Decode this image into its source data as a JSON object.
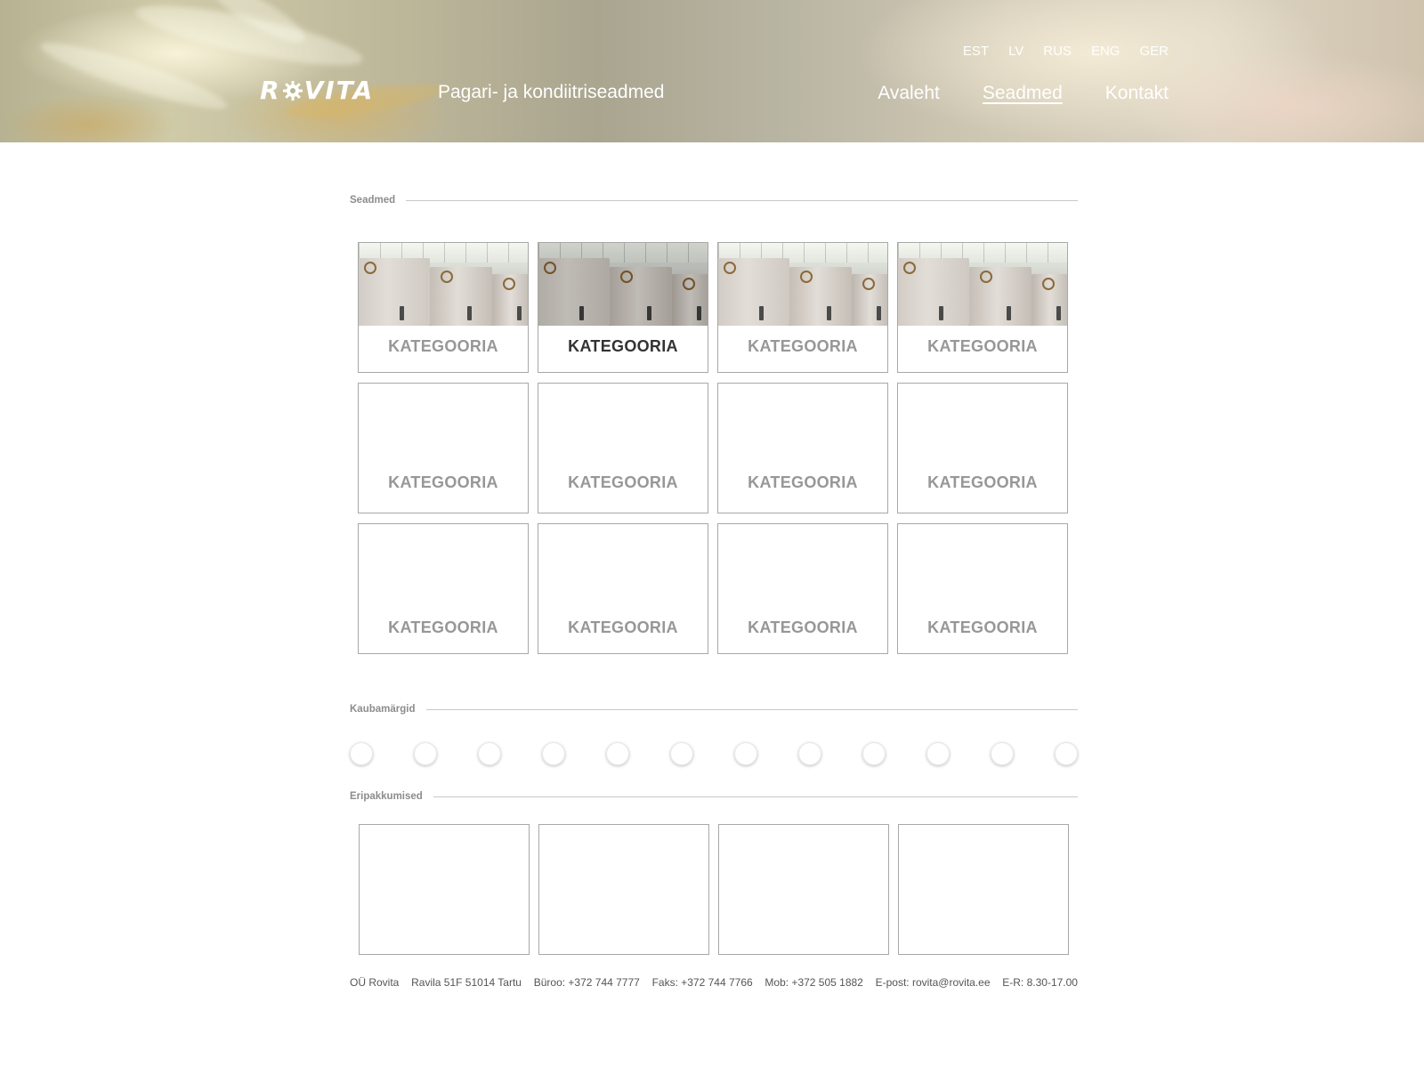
{
  "header": {
    "logo_text": "ROVITA",
    "tagline": "Pagari- ja kondiitriseadmed",
    "languages": [
      "EST",
      "LV",
      "RUS",
      "ENG",
      "GER"
    ],
    "nav": [
      {
        "label": "Avaleht",
        "active": false
      },
      {
        "label": "Seadmed",
        "active": true
      },
      {
        "label": "Kontakt",
        "active": false
      }
    ]
  },
  "sections": {
    "equipment": "Seadmed",
    "brands": "Kaubamärgid",
    "offers": "Eripakkumised"
  },
  "categories": [
    {
      "label": "KATEGOORIA",
      "has_image": true,
      "hover": false
    },
    {
      "label": "KATEGOORIA",
      "has_image": true,
      "hover": true
    },
    {
      "label": "KATEGOORIA",
      "has_image": true,
      "hover": false
    },
    {
      "label": "KATEGOORIA",
      "has_image": true,
      "hover": false
    },
    {
      "label": "KATEGOORIA",
      "has_image": false,
      "hover": false
    },
    {
      "label": "KATEGOORIA",
      "has_image": false,
      "hover": false
    },
    {
      "label": "KATEGOORIA",
      "has_image": false,
      "hover": false
    },
    {
      "label": "KATEGOORIA",
      "has_image": false,
      "hover": false
    },
    {
      "label": "KATEGOORIA",
      "has_image": false,
      "hover": false
    },
    {
      "label": "KATEGOORIA",
      "has_image": false,
      "hover": false
    },
    {
      "label": "KATEGOORIA",
      "has_image": false,
      "hover": false
    },
    {
      "label": "KATEGOORIA",
      "has_image": false,
      "hover": false
    }
  ],
  "brand_logo_count": 12,
  "offer_count": 4,
  "footer": {
    "company": "OÜ Rovita",
    "address": "Ravila 51F 51014 Tartu",
    "office": "Büroo: +372 744 7777",
    "fax": "Faks: +372 744 7766",
    "mobile": "Mob: +372 505 1882",
    "email": "E-post: rovita@rovita.ee",
    "hours": "E-R: 8.30-17.00"
  },
  "colors": {
    "card_border": "#a8a8a8",
    "label_muted": "#979797",
    "label_active": "#333333",
    "header_text": "#ffffff"
  }
}
